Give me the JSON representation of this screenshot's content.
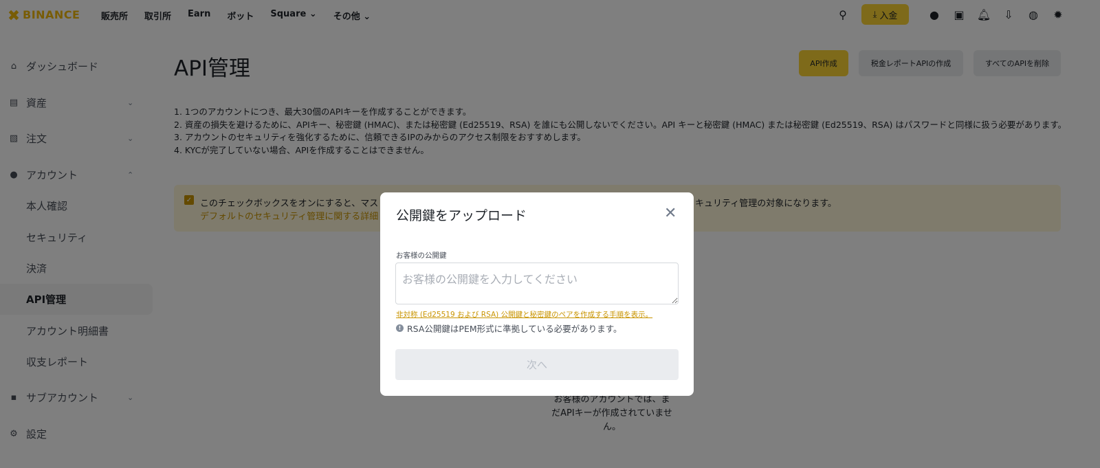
{
  "header": {
    "logo": "BINANCE",
    "nav": [
      "販売所",
      "取引所",
      "Earn",
      "ボット",
      "Square ⌄",
      "その他 ⌄"
    ],
    "deposit": "入金"
  },
  "sidebar": {
    "items": [
      {
        "label": "ダッシュボード",
        "icon": "home-icon"
      },
      {
        "label": "資産",
        "icon": "wallet-icon",
        "chevron": "⌄"
      },
      {
        "label": "注文",
        "icon": "orders-icon",
        "chevron": "⌄"
      },
      {
        "label": "アカウント",
        "icon": "user-icon",
        "chevron": "⌃"
      },
      {
        "label": "本人確認"
      },
      {
        "label": "セキュリティ"
      },
      {
        "label": "決済"
      },
      {
        "label": "API管理",
        "active": true
      },
      {
        "label": "アカウント明細書"
      },
      {
        "label": "収支レポート"
      },
      {
        "label": "サブアカウント",
        "icon": "sub-account-icon",
        "chevron": "⌄"
      },
      {
        "label": "設定",
        "icon": "gear-icon"
      }
    ]
  },
  "main": {
    "title": "API管理",
    "buttons": {
      "create": "API作成",
      "tax": "税金レポートAPIの作成",
      "delete_all": "すべてのAPIを削除"
    },
    "notes": [
      "1. 1つのアカウントにつき、最大30個のAPIキーを作成することができます。",
      "2. 資産の損失を避けるために、APIキー、秘密鍵 (HMAC)、または秘密鍵 (Ed25519、RSA) を誰にも公開しないでください。API キーと秘密鍵 (HMAC) または秘密鍵 (Ed25519、RSA) はパスワードと同様に扱う必要があります。",
      "3. アカウントのセキュリティを強化するために、信頼できるIPのみからのアクセス制限をおすすめします。",
      "4. KYCが完了していない場合、APIを作成することはできません。"
    ],
    "banner": {
      "text_left": "このチェックボックスをオンにすると、マス",
      "text_right": "キュリティ管理の対象になります。",
      "link": "デフォルトのセキュリティ管理に関する詳細"
    },
    "empty": "お客様のアカウントでは、まだAPIキーが作成されていません。"
  },
  "modal": {
    "title": "公開鍵をアップロード",
    "field_label": "お客様の公開鍵",
    "placeholder": "お客様の公開鍵を入力してください",
    "link": "非対称 (Ed25519 および RSA) 公開鍵と秘密鍵のペアを作成する手順を表示。",
    "warning": "RSA公開鍵はPEM形式に準拠している必要があります。",
    "next": "次へ"
  },
  "colors": {
    "brand": "#f0b90b",
    "accent": "#fcd535"
  }
}
